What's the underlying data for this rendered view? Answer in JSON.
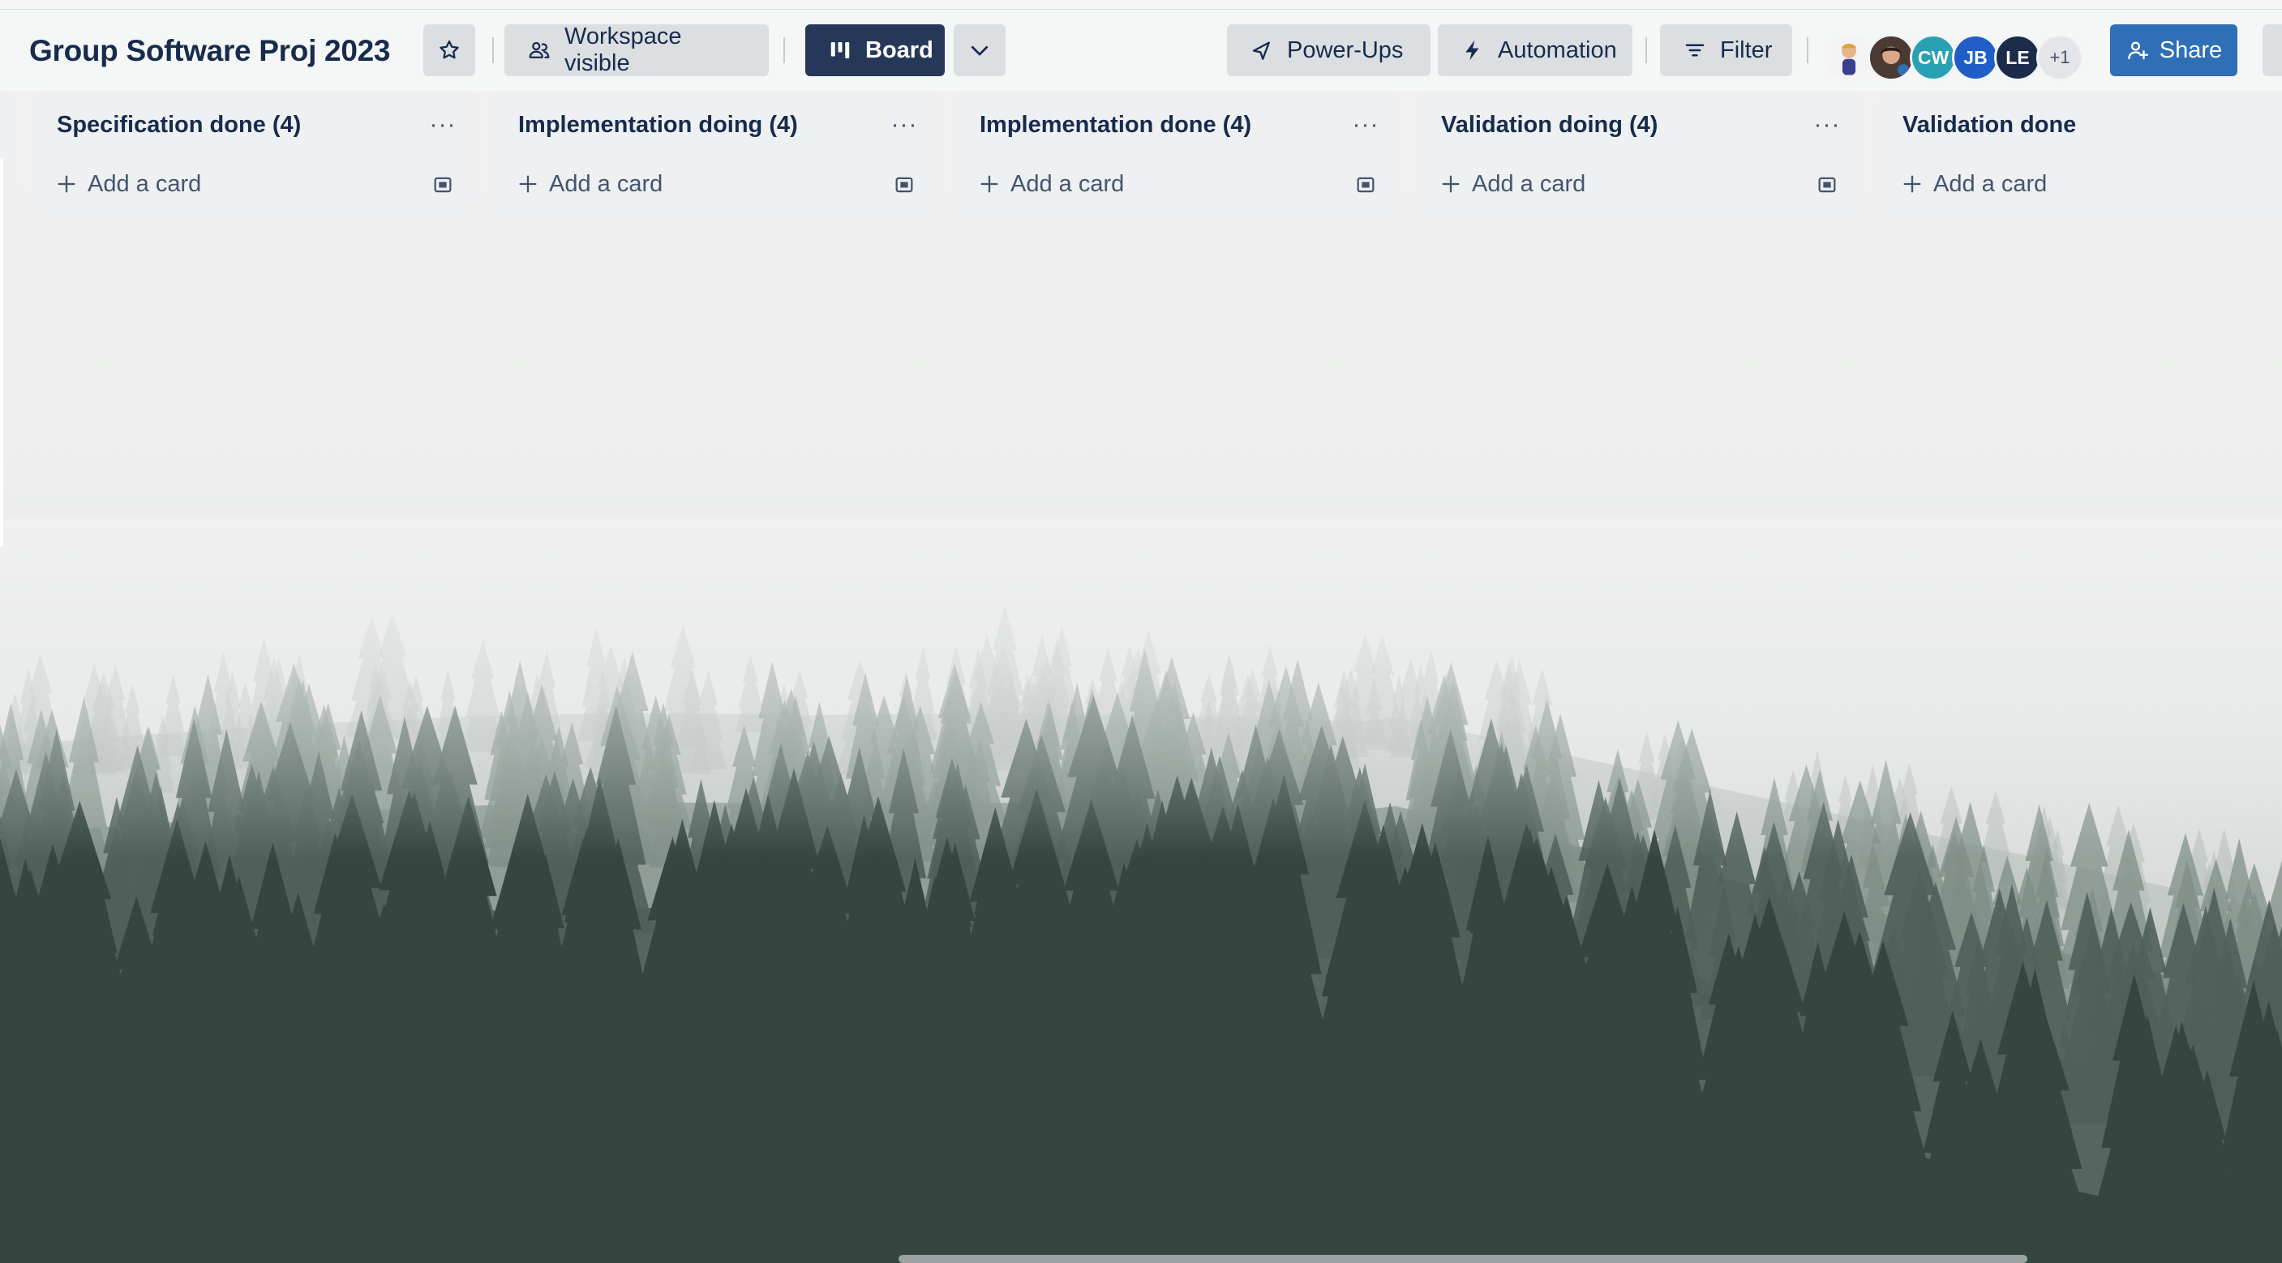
{
  "board": {
    "title": "Group Software Proj 2023",
    "visibility_label": "Workspace visible",
    "view_label": "Board",
    "powerups_label": "Power-Ups",
    "automation_label": "Automation",
    "filter_label": "Filter",
    "share_label": "Share"
  },
  "members": [
    {
      "initials": "",
      "type": "photo"
    },
    {
      "initials": "",
      "type": "photo"
    },
    {
      "initials": "CW",
      "color": "#2aa1b3"
    },
    {
      "initials": "JB",
      "color": "#1f5ec7"
    },
    {
      "initials": "LE",
      "color": "#1d2b4a"
    },
    {
      "initials": "+1",
      "color": "#e3e5e8"
    }
  ],
  "lists": [
    {
      "title": "Specification done (4)",
      "add_label": "Add a card"
    },
    {
      "title": "Implementation doing (4)",
      "add_label": "Add a card"
    },
    {
      "title": "Implementation done (4)",
      "add_label": "Add a card"
    },
    {
      "title": "Validation doing (4)",
      "add_label": "Add a card"
    },
    {
      "title": "Validation done",
      "add_label": "Add a card"
    }
  ],
  "icons": {
    "star": "star-icon",
    "visibility": "people-icon",
    "board": "board-icon",
    "view_toggle": "chevron-down-icon",
    "powerups": "rocket-icon",
    "automation": "lightning-icon",
    "filter": "filter-icon",
    "share": "add-person-icon",
    "list_menu": "ellipsis-icon",
    "add": "plus-icon",
    "template": "template-icon"
  },
  "colors": {
    "board_button": "#253858",
    "share_button": "#2f6fb5",
    "list_bg": "#eef0f2"
  }
}
